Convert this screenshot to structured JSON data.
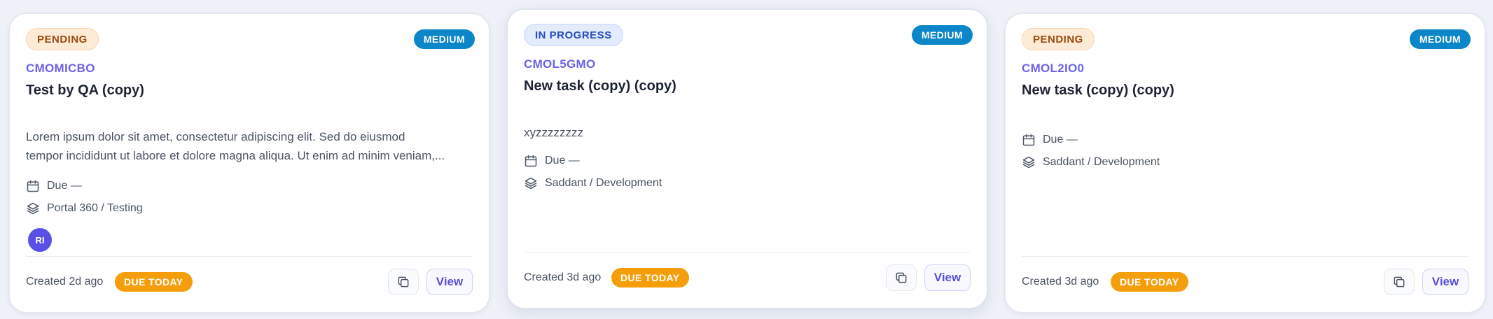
{
  "cards": [
    {
      "status": "PENDING",
      "priority": "MEDIUM",
      "code": "CMOMICBO",
      "title": "Test by QA (copy)",
      "description_lines": [
        "Lorem ipsum dolor sit amet, consectetur adipiscing elit. Sed do eiusmod",
        "tempor incididunt ut labore et dolore magna aliqua. Ut enim ad minim veniam,..."
      ],
      "due": "Due —",
      "project": "Portal 360 / Testing",
      "avatar_initials": "RI",
      "created": "Created 2d ago",
      "due_badge": "DUE TODAY",
      "view_label": "View"
    },
    {
      "status": "IN PROGRESS",
      "priority": "MEDIUM",
      "code": "CMOL5GMO",
      "title": "New task (copy) (copy)",
      "description_lines": [
        "xyzzzzzzzz"
      ],
      "due": "Due —",
      "project": "Saddant / Development",
      "created": "Created 3d ago",
      "due_badge": "DUE TODAY",
      "view_label": "View"
    },
    {
      "status": "PENDING",
      "priority": "MEDIUM",
      "code": "CMOL2IO0",
      "title": "New task (copy) (copy)",
      "due": "Due —",
      "project": "Saddant / Development",
      "created": "Created 3d ago",
      "due_badge": "DUE TODAY",
      "view_label": "View"
    }
  ],
  "colors": {
    "accent": "#6b63e6",
    "priority_medium": "#0a86c9",
    "due_today": "#f59e0b",
    "pending_bg": "#fdebd6",
    "in_progress_bg": "#e3ebfd"
  },
  "icons": {
    "due": "calendar-icon",
    "project": "layers-icon",
    "copy": "copy-icon"
  }
}
